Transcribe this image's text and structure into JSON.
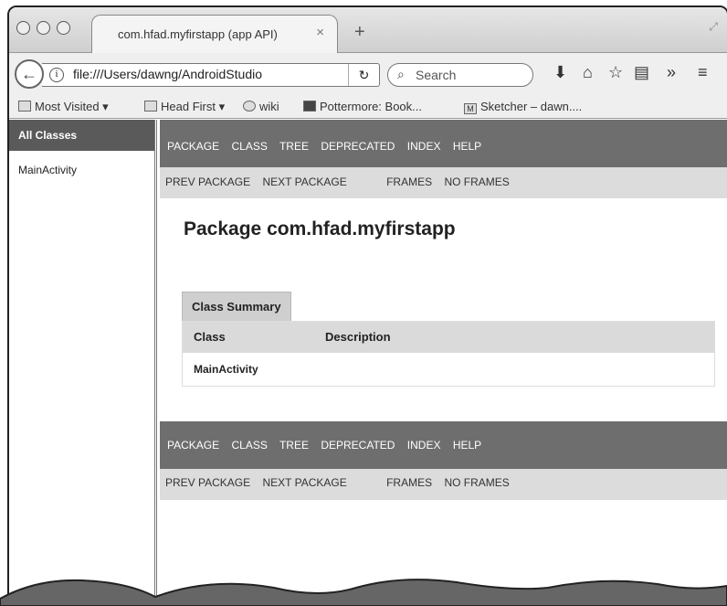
{
  "browser": {
    "tab_title": "com.hfad.myfirstapp (app API)",
    "tab_close": "×",
    "new_tab": "+",
    "url": "file:///Users/dawng/AndroidStudio",
    "search_placeholder": "Search",
    "bookmarks": [
      "Most Visited ▾",
      "Head First ▾",
      "wiki",
      "Pottermore: Book...",
      "Sketcher – dawn...."
    ]
  },
  "sidebar": {
    "heading": "All Classes",
    "classes": [
      "MainActivity"
    ]
  },
  "nav": {
    "top_items": [
      "PACKAGE",
      "CLASS",
      "TREE",
      "DEPRECATED",
      "INDEX",
      "HELP"
    ],
    "sub_items": [
      "PREV PACKAGE",
      "NEXT PACKAGE",
      "FRAMES",
      "NO FRAMES"
    ]
  },
  "page": {
    "title": "Package com.hfad.myfirstapp",
    "summary_tab": "Class Summary",
    "columns": [
      "Class",
      "Description"
    ],
    "rows": [
      {
        "class": "MainActivity",
        "description": ""
      }
    ]
  }
}
